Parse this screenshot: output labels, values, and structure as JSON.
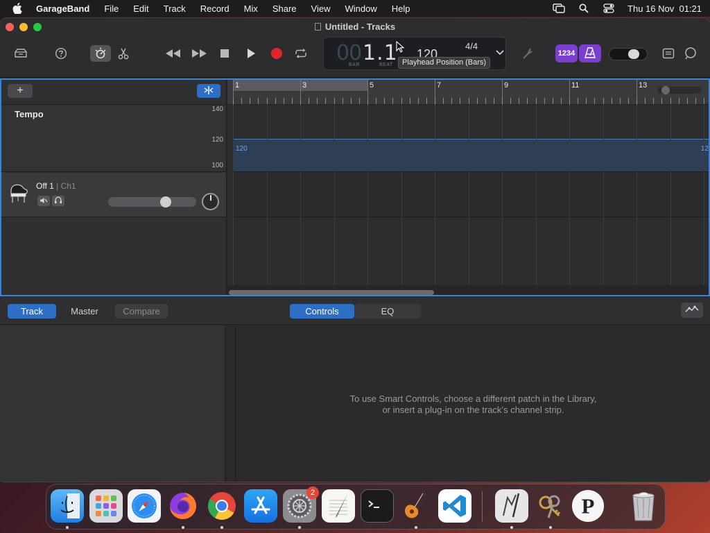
{
  "menubar": {
    "app_name": "GarageBand",
    "items": [
      "File",
      "Edit",
      "Track",
      "Record",
      "Mix",
      "Share",
      "View",
      "Window",
      "Help"
    ],
    "clock": "Thu 16 Nov  01:21"
  },
  "window": {
    "title": "Untitled - Tracks"
  },
  "lcd": {
    "bar_digits": "00",
    "position": "1.1",
    "bar_label": "BAR",
    "beat_label": "BEAT",
    "tempo": "120",
    "time_signature": "4/4",
    "tooltip": "Playhead Position (Bars)"
  },
  "toolbar": {
    "count_in_label": "1234",
    "record_color": "#e0262a",
    "accent_purple": "#7b3fd0"
  },
  "tracks": {
    "add_label": "+",
    "tempo_track": {
      "name": "Tempo",
      "scale_high": "140",
      "scale_mid": "120",
      "scale_low": "100",
      "value": "120",
      "value_end": "12"
    },
    "instrument_track": {
      "name": "Off 1",
      "separator": " | ",
      "channel": "Ch1",
      "volume": 0.68
    },
    "ruler_bars": [
      "1",
      "3",
      "5",
      "7",
      "9",
      "11",
      "13"
    ]
  },
  "editor": {
    "tabs_left": [
      "Track",
      "Master",
      "Compare"
    ],
    "tabs_center": [
      "Controls",
      "EQ"
    ],
    "message_line1": "To use Smart Controls, choose a different patch in the Library,",
    "message_line2": "or insert a plug-in on the track’s channel strip."
  },
  "dock": {
    "apps": [
      "Finder",
      "Launchpad",
      "Safari",
      "Firefox",
      "Chrome",
      "App Store",
      "System Settings",
      "TextEdit",
      "Terminal",
      "GarageBand",
      "Visual Studio Code",
      "Script Editor",
      "Keychain Access",
      "P",
      "Trash"
    ],
    "system_settings_badge": "2"
  },
  "colors": {
    "selection_blue": "#3a83d9",
    "active_tab_blue": "#2c6fc4",
    "tempo_line": "#4a7ab8"
  }
}
